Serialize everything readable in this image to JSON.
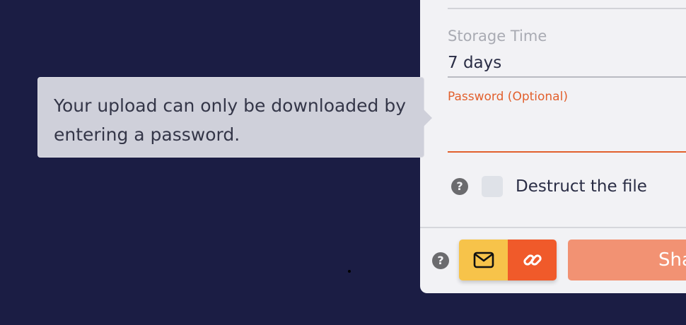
{
  "form": {
    "storage_time_label": "Storage Time",
    "storage_time_value": "7 days",
    "password_label": "Password (Optional)",
    "password_value": "",
    "destruct_label": "Destruct the file",
    "destruct_checked": false,
    "help_icon_glyph": "?"
  },
  "actions": {
    "email_icon": "envelope-icon",
    "link_icon": "link-icon",
    "share_label": "Share"
  },
  "tooltip": {
    "text": "Your upload can only be downloaded by entering a password."
  },
  "colors": {
    "background": "#1b1d44",
    "panel": "#f2f2f5",
    "accent_orange": "#e2602d",
    "email_button": "#f7c34a",
    "link_button": "#f05a2a",
    "share_button": "#f29273",
    "tooltip": "#cfd0da"
  }
}
